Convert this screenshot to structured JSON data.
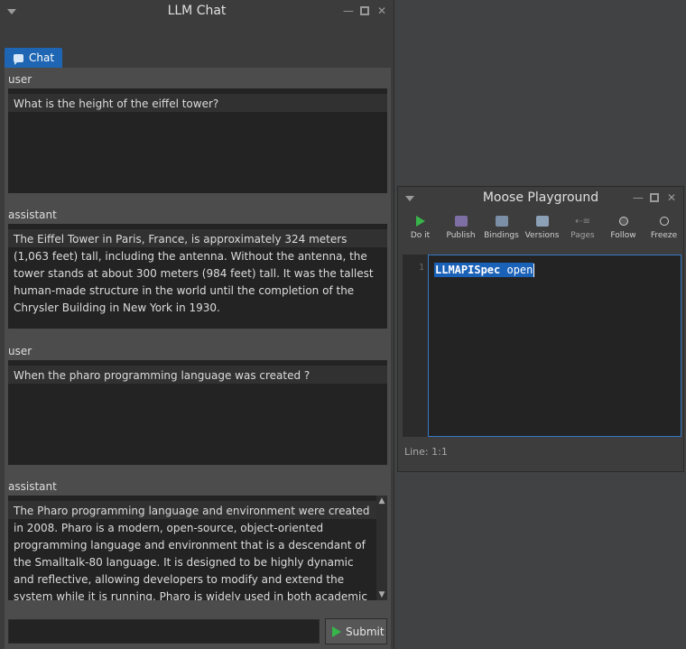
{
  "chat_window": {
    "title": "LLM Chat",
    "tab": {
      "label": "Chat"
    },
    "messages": [
      {
        "role": "user",
        "text": "What is the height of the eiffel tower?"
      },
      {
        "role": "assistant",
        "text": "The Eiffel Tower in Paris, France, is approximately 324 meters (1,063 feet) tall, including the antenna. Without the antenna, the tower stands at about 300 meters (984 feet) tall. It was the tallest human-made structure in the world until the completion of the Chrysler Building in New York in 1930."
      },
      {
        "role": "user",
        "text": "When the pharo programming language was created ?"
      },
      {
        "role": "assistant",
        "text": "The Pharo programming language and environment were created in 2008. Pharo is a modern, open-source, object-oriented programming language and environment that is a descendant of the Smalltalk-80 language. It is designed to be highly dynamic and reflective, allowing developers to modify and extend the system while it is running. Pharo is widely used in both academic and industrial settings for its powerful"
      }
    ],
    "input": {
      "value": "",
      "placeholder": ""
    },
    "submit_label": "Submit"
  },
  "playground": {
    "title": "Moose Playground",
    "toolbar": [
      {
        "label": "Do it",
        "icon": "play-icon"
      },
      {
        "label": "Publish",
        "icon": "publish-icon"
      },
      {
        "label": "Bindings",
        "icon": "bindings-icon"
      },
      {
        "label": "Versions",
        "icon": "versions-icon"
      },
      {
        "label": "Pages",
        "icon": "pages-icon"
      },
      {
        "label": "Follow",
        "icon": "follow-icon"
      },
      {
        "label": "Freeze",
        "icon": "freeze-icon"
      }
    ],
    "editor": {
      "line_number": "1",
      "code_class": "LLMAPISpec",
      "code_message": " open"
    },
    "status": "Line: 1:1"
  },
  "colors": {
    "accent": "#1e66b3",
    "play_green": "#37b54a",
    "selection": "#1a61b8"
  }
}
